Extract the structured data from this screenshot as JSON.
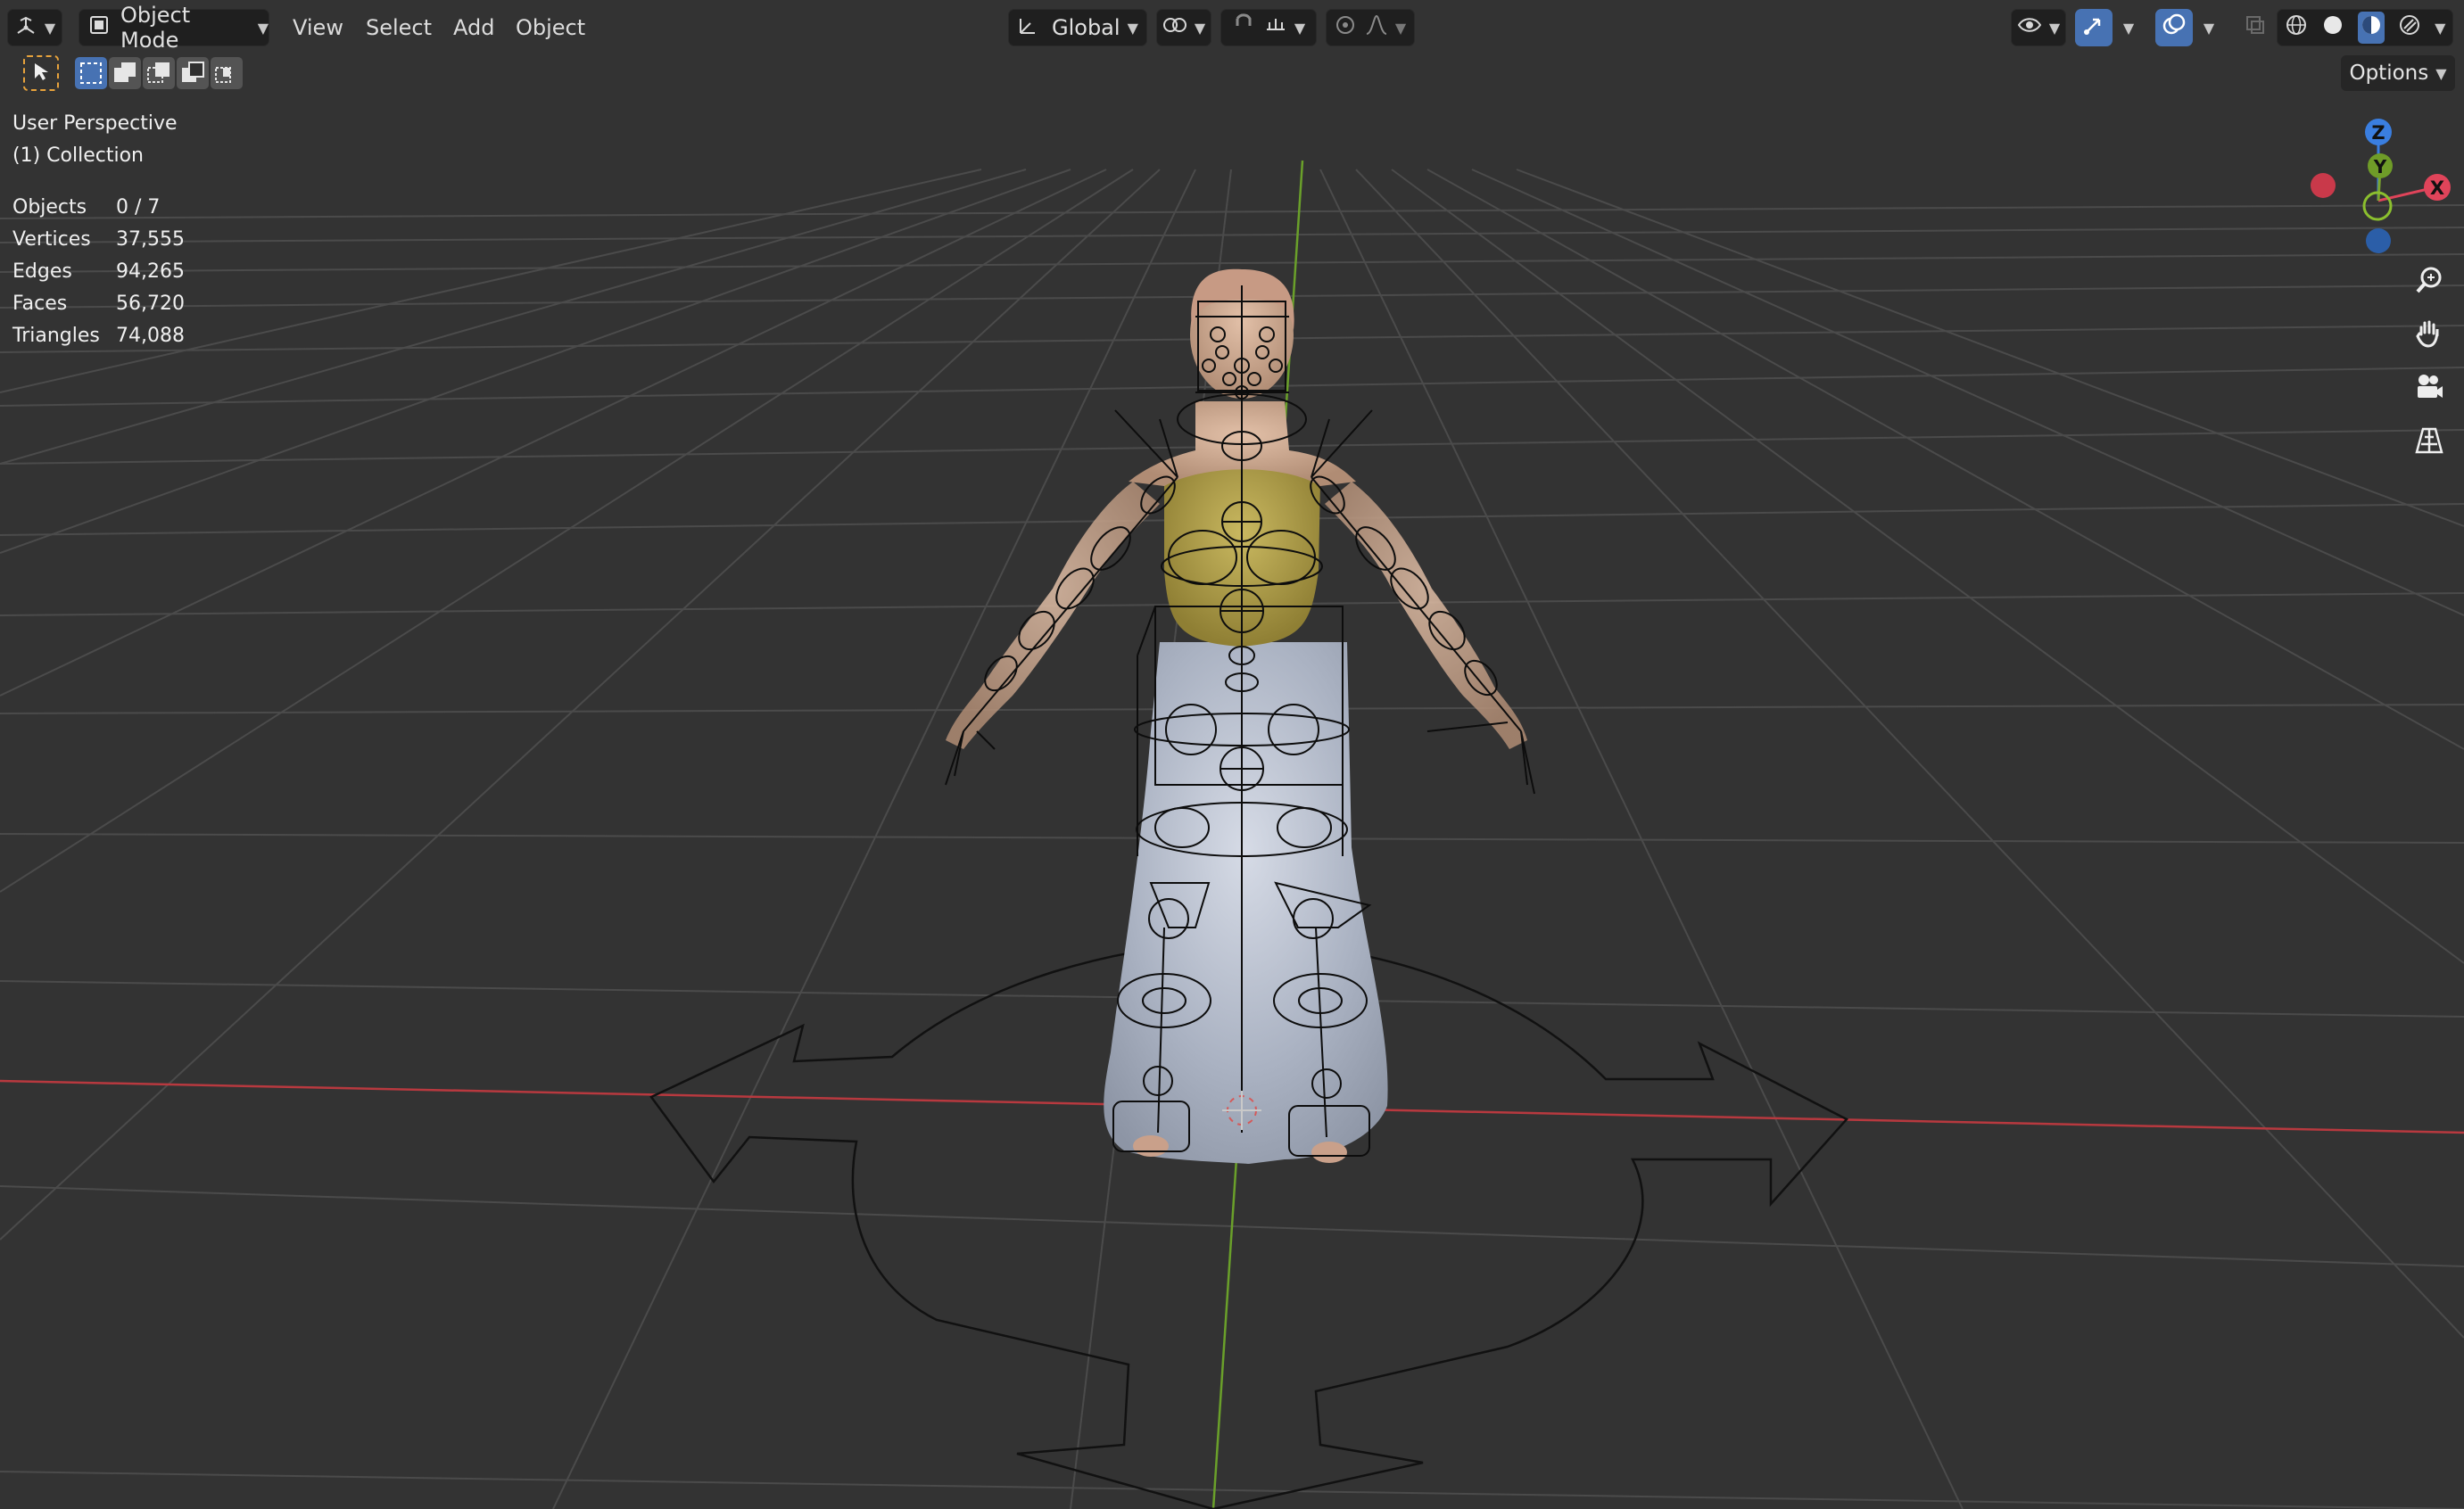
{
  "header": {
    "editor_type_icon": "3d-viewport-icon",
    "mode_label": "Object Mode",
    "menus": [
      "View",
      "Select",
      "Add",
      "Object"
    ],
    "transform_orientation": "Global",
    "options_label": "Options"
  },
  "overlay": {
    "view_name": "User Perspective",
    "collection": "(1) Collection",
    "stats": [
      {
        "label": "Objects",
        "value": "0 / 7"
      },
      {
        "label": "Vertices",
        "value": "37,555"
      },
      {
        "label": "Edges",
        "value": "94,265"
      },
      {
        "label": "Faces",
        "value": "56,720"
      },
      {
        "label": "Triangles",
        "value": "74,088"
      }
    ]
  },
  "gizmo": {
    "z_label": "Z",
    "y_label": "Y",
    "x_label": "X",
    "colors": {
      "x": "#e0445a",
      "y": "#7ba52d",
      "z": "#3a7ee0"
    }
  },
  "nav_icons": [
    "zoom-icon",
    "hand-pan-icon",
    "camera-icon",
    "grid-perspective-icon"
  ],
  "colors": {
    "background": "#333333",
    "grid": "#4a4a4a",
    "x_axis": "#b8393f",
    "y_axis": "#6aa02a",
    "selection_accent": "#e8a33c",
    "active_blue": "#4772b3"
  }
}
